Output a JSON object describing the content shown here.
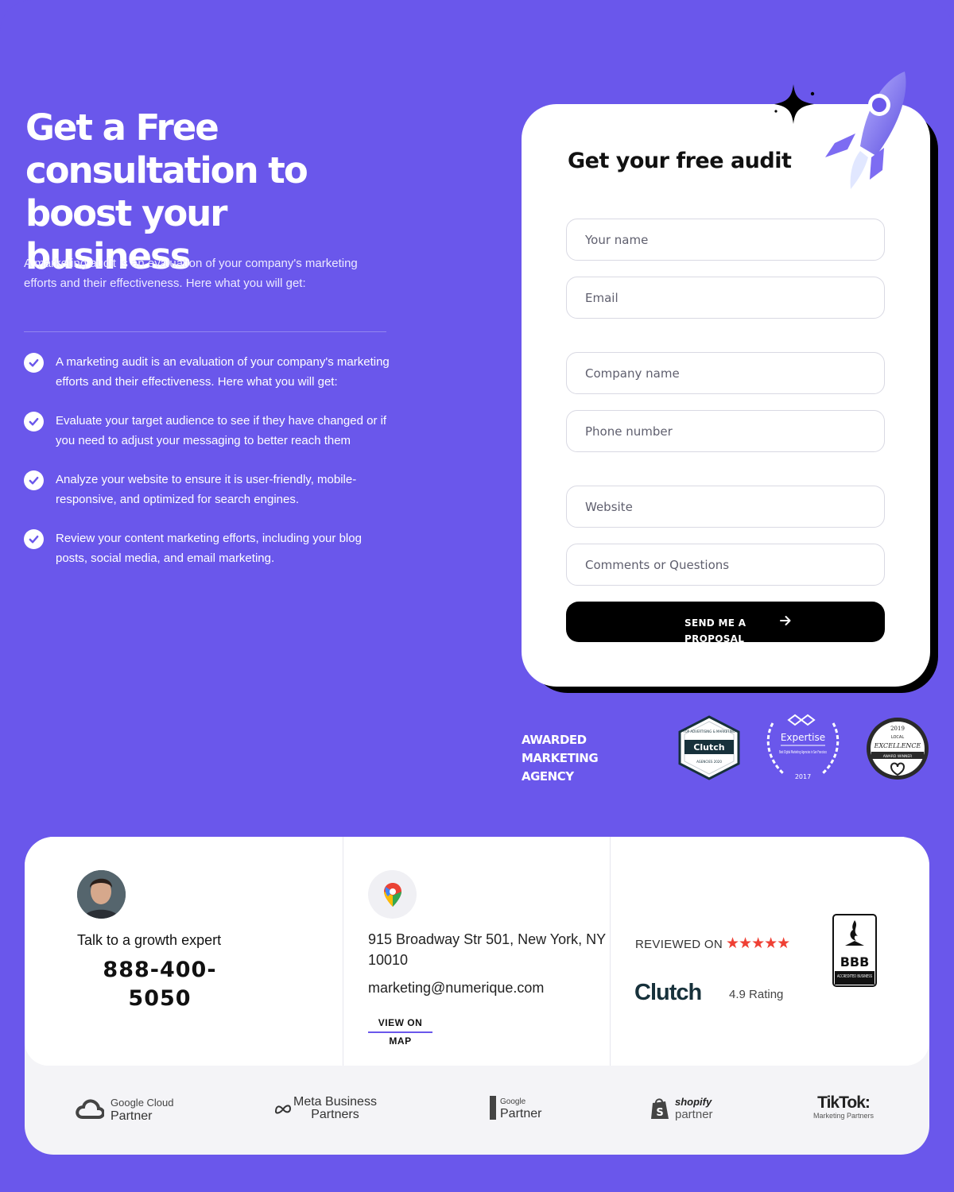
{
  "hero": {
    "title": "Get a Free consultation to boost your business",
    "intro": "A marketing audit is an evaluation of your company's marketing efforts and their effectiveness. Here what you will get:",
    "benefits": [
      "A marketing audit is an evaluation of your company's marketing efforts and their effectiveness. Here what you will get:",
      "Evaluate your target audience to see if they have changed or if you need to adjust your messaging to better reach them",
      "Analyze your website to ensure it is user-friendly, mobile-responsive, and optimized for search engines.",
      "Review your content marketing efforts, including your blog posts, social media, and email marketing."
    ]
  },
  "form": {
    "title": "Get your free audit",
    "fields": {
      "name": "Your name",
      "email": "Email",
      "company": "Company name",
      "phone": "Phone number",
      "website": "Website",
      "comments": "Comments or Questions"
    },
    "submit_label": "SEND ME A PROPOSAL"
  },
  "awards": {
    "label_lines": [
      "AWARDED",
      "MARKETING",
      "AGENCY"
    ],
    "clutch_badge": {
      "top": "TOP ADVERTISING & MARKETING",
      "brand": "Clutch",
      "bottom": "AGENCIES 2020"
    },
    "expertise_badge": {
      "brand": "Expertise",
      "text": "Best Digital Marketing Agencies in San Francisco",
      "year": "2017"
    },
    "excellence_badge": {
      "year": "2019",
      "top": "LOCAL",
      "title": "EXCELLENCE",
      "bottom": "AWARD WINNER"
    }
  },
  "contact": {
    "expert_label": "Talk to a growth expert",
    "phone": "888-400-5050",
    "address": "915 Broadway Str 501, New York, NY 10010",
    "email": "marketing@numerique.com",
    "map_link": [
      "VIEW ON",
      "MAP"
    ],
    "reviewed_on": "REVIEWED ON",
    "stars": 5,
    "clutch": "Clutch",
    "rating": "4.9 Rating",
    "bbb": {
      "logo": "BBB",
      "sub": "ACCREDITED BUSINESS"
    }
  },
  "partners": [
    {
      "icon": "google-cloud-icon",
      "line1": "Google Cloud",
      "line2": "Partner"
    },
    {
      "icon": "meta-icon",
      "line1": "Meta Business",
      "line2": "Partners"
    },
    {
      "icon": "google-partner-icon",
      "line1": "Google",
      "line2": "Partner"
    },
    {
      "icon": "shopify-icon",
      "line1": "shopify",
      "line2": "partner"
    },
    {
      "icon": "tiktok-icon",
      "line1": "TikTok:",
      "line2": "Marketing Partners"
    }
  ],
  "colors": {
    "background": "#6a57eb",
    "accent": "#6a57eb",
    "star": "#ef4034",
    "text_dark": "#111111"
  }
}
